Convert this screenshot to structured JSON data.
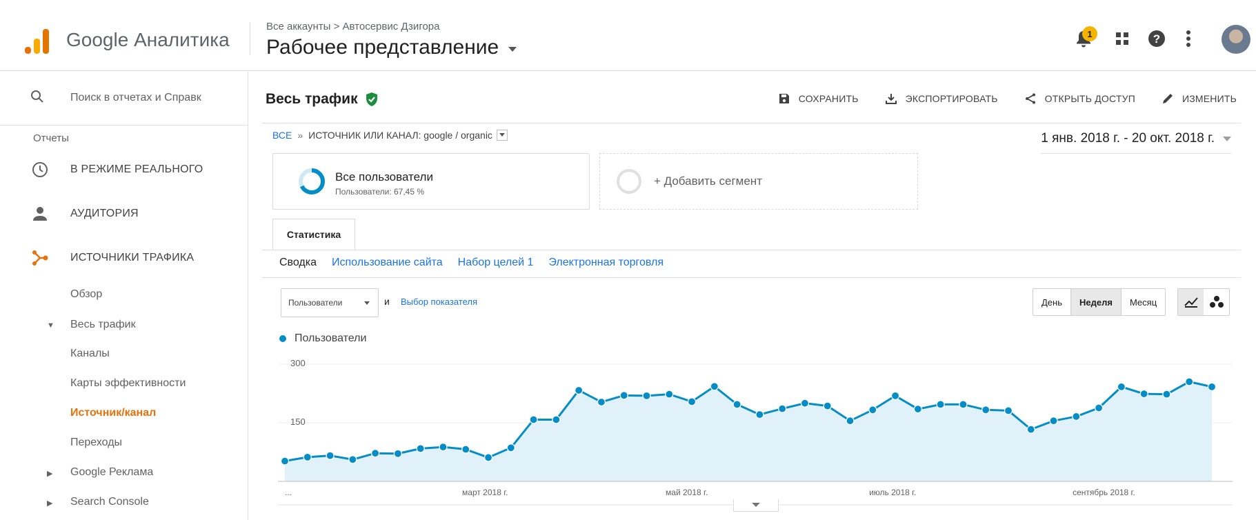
{
  "header": {
    "brand": "Google Аналитика",
    "breadcrumb": "Все аккаунты > Автосервис Дзигора",
    "view": "Рабочее представление",
    "notifications_count": "1"
  },
  "sidebar": {
    "search_placeholder": "Поиск в отчетах и Справк",
    "section": "Отчеты",
    "items": [
      {
        "label": "В РЕЖИМЕ РЕАЛЬНОГО"
      },
      {
        "label": "АУДИТОРИЯ"
      },
      {
        "label": "ИСТОЧНИКИ ТРАФИКА"
      }
    ],
    "sub": {
      "overview": "Обзор",
      "all_traffic": "Весь трафик",
      "channels": "Каналы",
      "treemaps": "Карты эффективности",
      "source_medium": "Источник/канал",
      "referrals": "Переходы",
      "google_ads": "Google Реклама",
      "search_console": "Search Console"
    }
  },
  "report": {
    "title": "Весь трафик",
    "actions": {
      "save": "СОХРАНИТЬ",
      "export": "ЭКСПОРТИРОВАТЬ",
      "share": "ОТКРЫТЬ ДОСТУП",
      "edit": "ИЗМЕНИТЬ"
    },
    "bc_all": "ВСЕ",
    "bc_sep": "»",
    "bc_dim": "ИСТОЧНИК ИЛИ КАНАЛ: google / organic",
    "date_range": "1 янв. 2018 г. - 20 окт. 2018 г.",
    "segment": {
      "name": "Все пользователи",
      "pct": "Пользователи: 67,45 %",
      "add": "+ Добавить сегмент"
    },
    "tab": "Статистика",
    "subtabs": [
      "Сводка",
      "Использование сайта",
      "Набор целей 1",
      "Электронная торговля"
    ],
    "metric": "Пользователи",
    "and": "и",
    "pick_metric": "Выбор показателя",
    "periods": [
      "День",
      "Неделя",
      "Месяц"
    ]
  },
  "chart_data": {
    "type": "area",
    "series": [
      {
        "name": "Пользователи",
        "values": [
          52,
          62,
          66,
          56,
          72,
          71,
          84,
          88,
          82,
          61,
          86,
          158,
          158,
          233,
          203,
          220,
          219,
          223,
          204,
          243,
          197,
          171,
          186,
          200,
          193,
          155,
          183,
          219,
          185,
          197,
          197,
          183,
          181,
          133,
          155,
          166,
          188,
          242,
          224,
          223,
          255,
          242
        ]
      }
    ],
    "yticks": [
      "300",
      "150"
    ],
    "ylim": [
      0,
      300
    ],
    "xticks": [
      {
        "label": "...",
        "index": 0
      },
      {
        "label": "март 2018 г.",
        "index": 9
      },
      {
        "label": "май 2018 г.",
        "index": 18
      },
      {
        "label": "июль 2018 г.",
        "index": 27
      },
      {
        "label": "сентябрь 2018 г.",
        "index": 36
      }
    ],
    "color": "#058dc7",
    "fill": "#e1f1f9"
  }
}
